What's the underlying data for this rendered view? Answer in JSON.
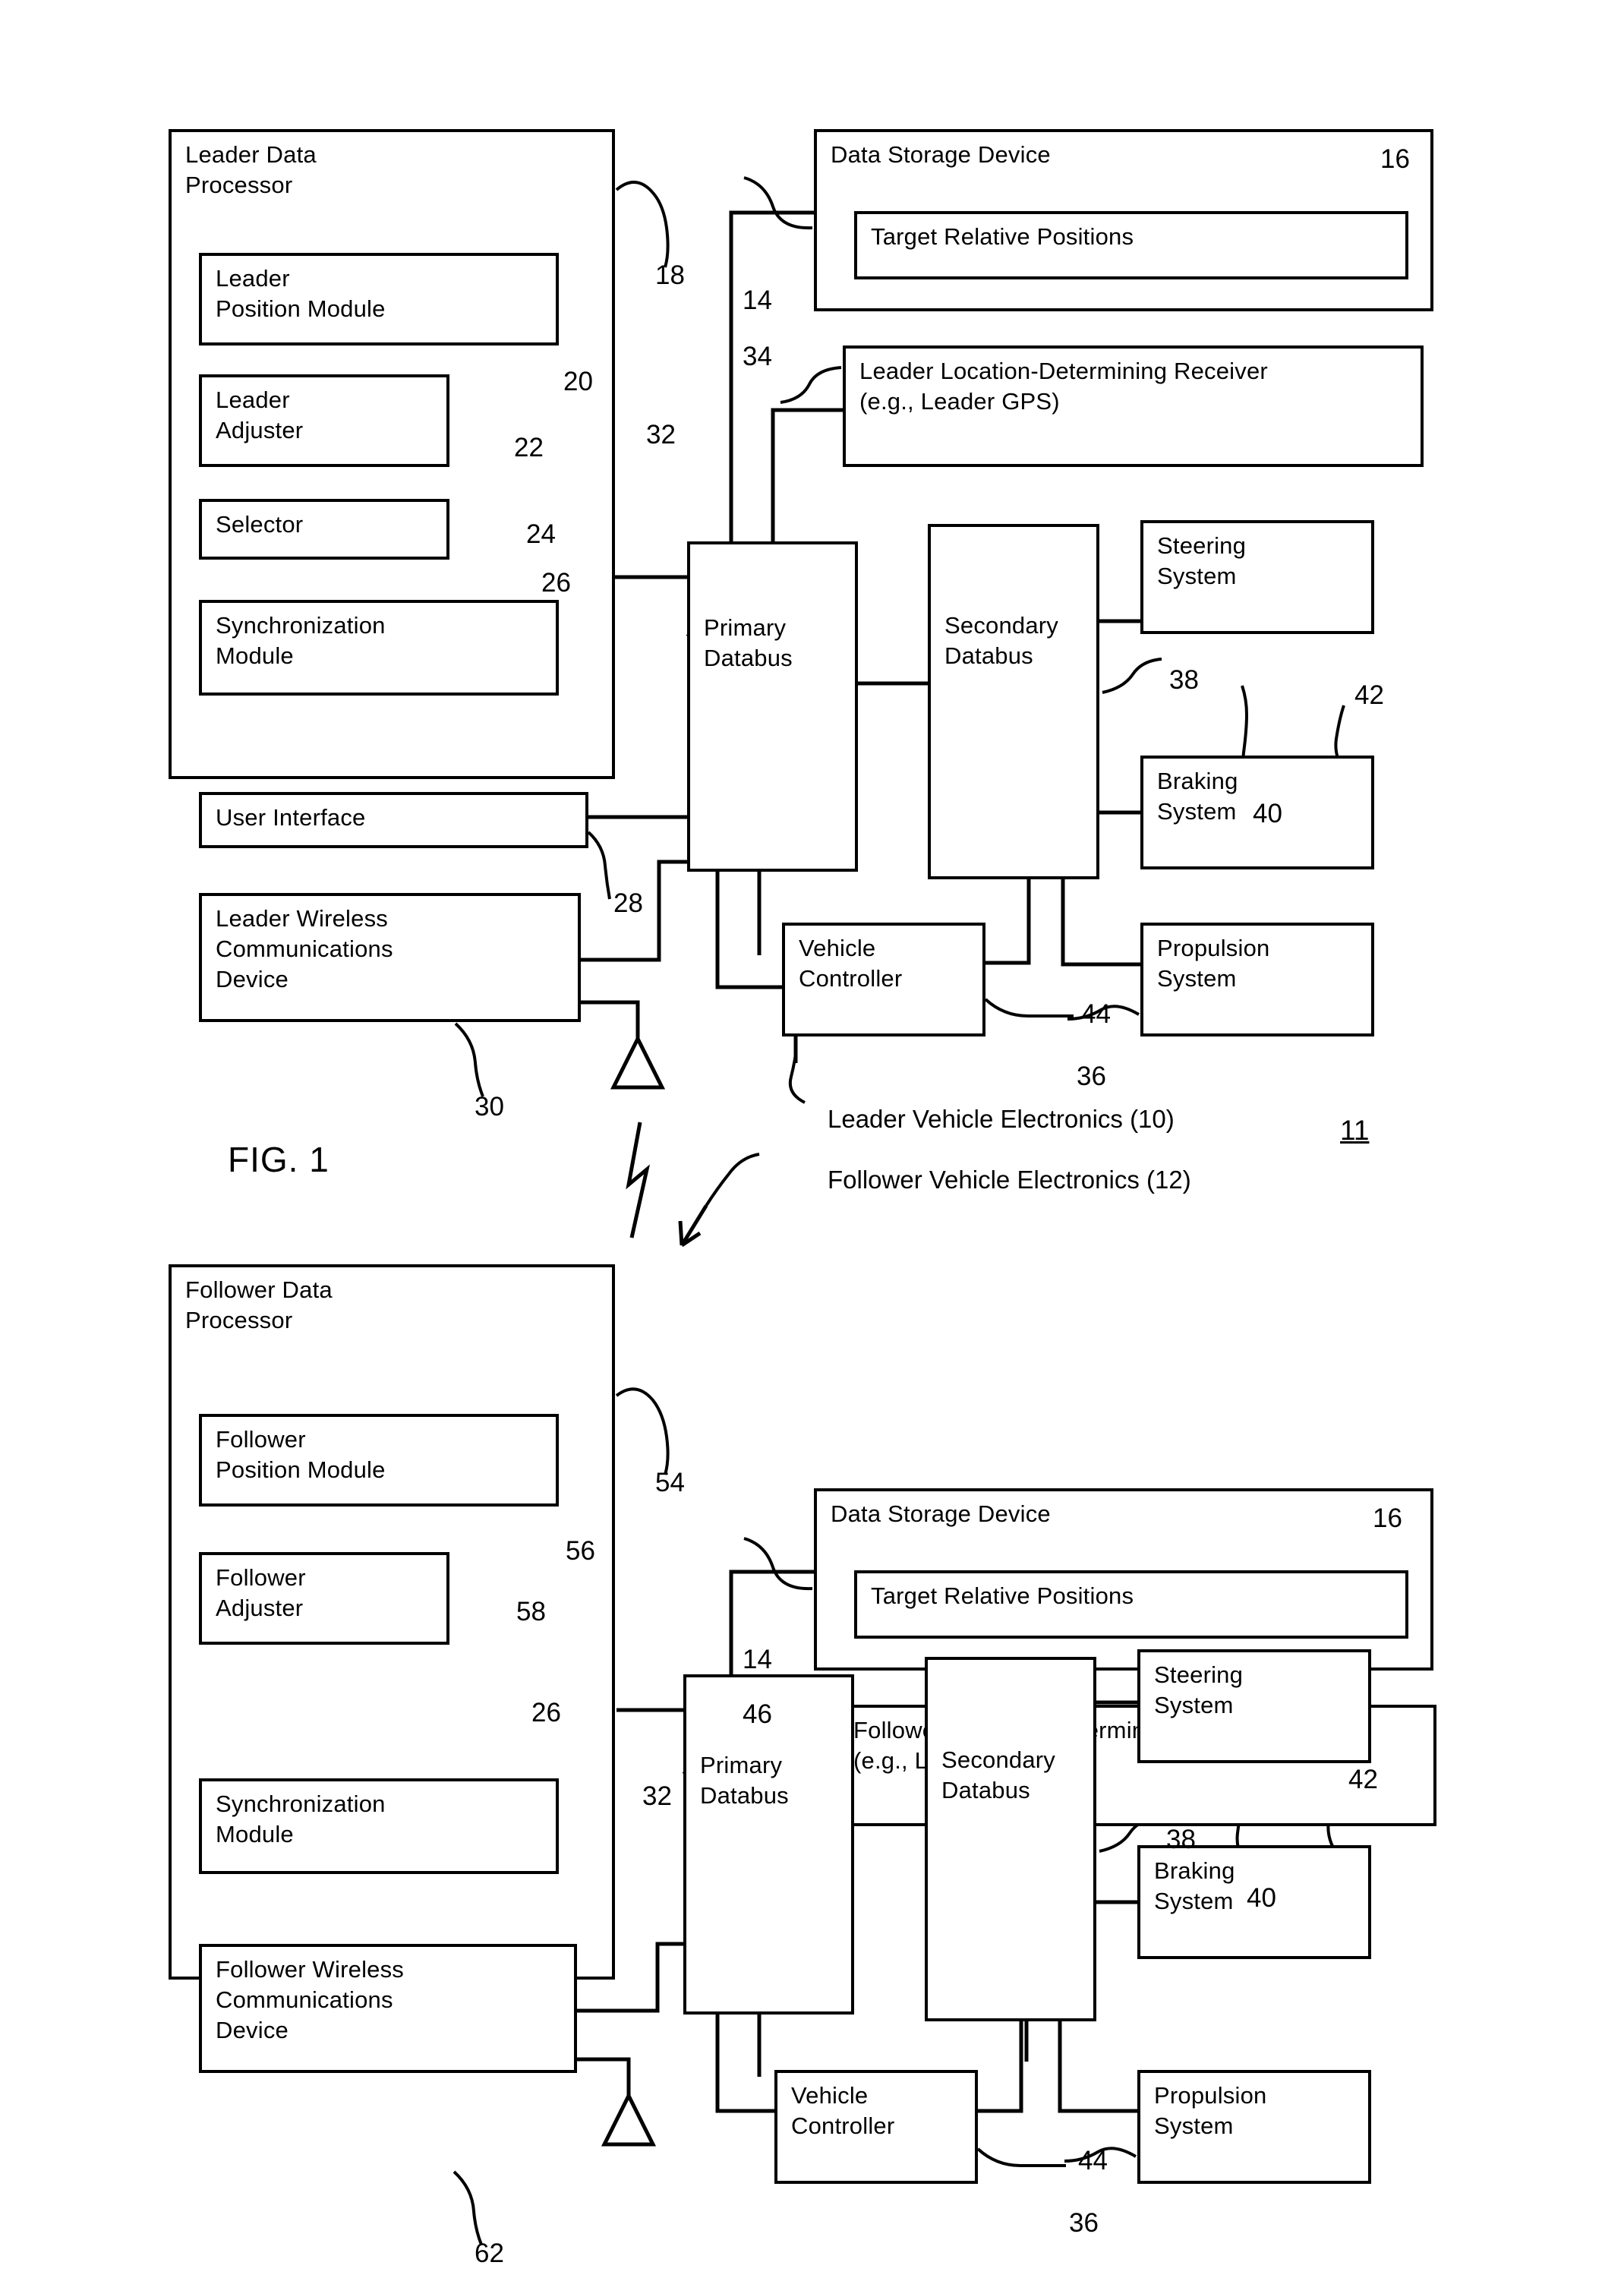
{
  "figure1": {
    "label": "FIG. 1",
    "sheet_number": "11",
    "blocks": {
      "leader_data_processor": "Leader Data\nProcessor",
      "leader_position_module": "Leader\nPosition Module",
      "leader_adjuster": "Leader\nAdjuster",
      "selector": "Selector",
      "synchronization_module": "Synchronization\nModule",
      "user_interface": "User Interface",
      "leader_wireless_comm": "Leader Wireless\nCommunications\nDevice",
      "data_storage_device": "Data Storage Device",
      "target_relative_positions": "Target Relative Positions",
      "leader_receiver": "Leader Location-Determining Receiver\n(e.g., Leader GPS)",
      "primary_databus": "Primary\nDatabus",
      "secondary_databus": "Secondary\nDatabus",
      "steering_system": "Steering\nSystem",
      "braking_system": "Braking\nSystem",
      "vehicle_controller": "Vehicle\nController",
      "propulsion_system": "Propulsion\nSystem"
    },
    "refs": {
      "leader_data_processor": "18",
      "leader_position_module": "20",
      "leader_adjuster": "22",
      "selector": "24",
      "synchronization_module": "26",
      "user_interface": "28",
      "leader_wireless_comm": "30",
      "data_storage_device_outer": "14",
      "target_relative_positions": "16",
      "leader_receiver": "34",
      "primary_databus": "32",
      "secondary_databus": "38",
      "steering_system": "40",
      "braking_system": "42",
      "vehicle_controller": "36",
      "propulsion_system": "44"
    },
    "annotations": {
      "leader_vehicle_electronics": "Leader Vehicle Electronics (10)",
      "follower_vehicle_electronics": "Follower Vehicle Electronics (12)"
    }
  },
  "figure2": {
    "blocks": {
      "follower_data_processor": "Follower Data\nProcessor",
      "follower_position_module": "Follower\nPosition Module",
      "follower_adjuster": "Follower\nAdjuster",
      "synchronization_module": "Synchronization\nModule",
      "follower_wireless_comm": "Follower Wireless\nCommunications\nDevice",
      "data_storage_device": "Data Storage Device",
      "target_relative_positions": "Target Relative Positions",
      "follower_receiver": "Follower Location-Determining Receiver\n(e.g., Leader GPS)",
      "primary_databus": "Primary\nDatabus",
      "secondary_databus": "Secondary\nDatabus",
      "steering_system": "Steering\nSystem",
      "braking_system": "Braking\nSystem",
      "vehicle_controller": "Vehicle\nController",
      "propulsion_system": "Propulsion\nSystem"
    },
    "refs": {
      "follower_data_processor": "54",
      "follower_position_module": "56",
      "follower_adjuster": "58",
      "synchronization_module": "26",
      "follower_wireless_comm": "62",
      "data_storage_device_outer": "14",
      "target_relative_positions": "16",
      "follower_receiver": "46",
      "primary_databus": "32",
      "secondary_databus": "38",
      "steering_system": "40",
      "braking_system": "42",
      "vehicle_controller": "36",
      "propulsion_system": "44"
    }
  },
  "colors": {
    "ink": "#000000",
    "paper": "#ffffff"
  }
}
